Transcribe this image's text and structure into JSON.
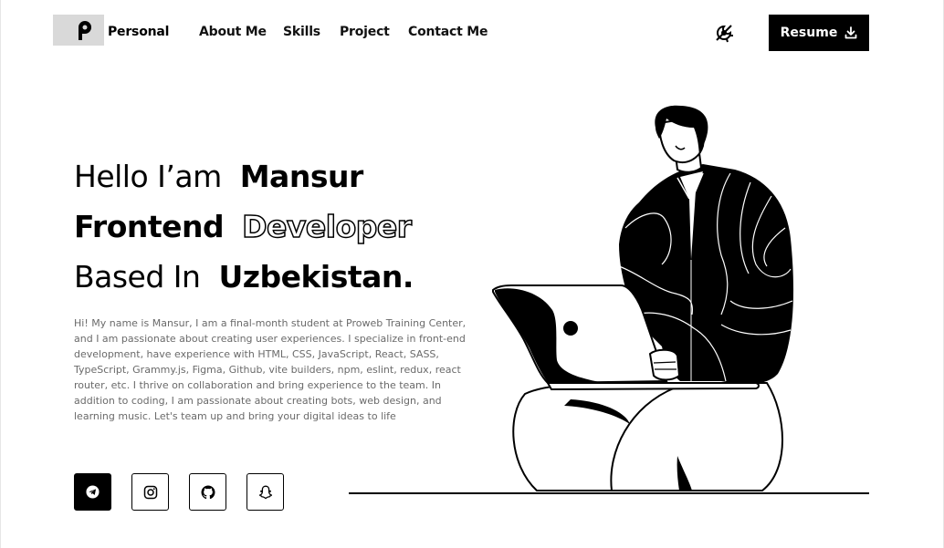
{
  "header": {
    "brand": "Personal",
    "nav": [
      "About Me",
      "Skills",
      "Project",
      "Contact Me"
    ],
    "resume_label": "Resume"
  },
  "hero": {
    "line1_prefix": "Hello I’am",
    "line1_name": "Mansur",
    "line2_role": "Frontend",
    "line2_outline": "Developer",
    "line3_prefix": "Based In",
    "line3_place": "Uzbekistan.",
    "intro": "Hi! My name is Mansur, I am a final-month student at Proweb Training Center, and I am passionate about creating user experiences. I specialize in front-end development, have experience with HTML, CSS, JavaScript, React, SASS, TypeScript, Grammy.js, Figma, Github, vite builders, npm, eslint, redux, react router, etc. I thrive on collaboration and bring experience to the team. In addition to coding, I am passionate about creating bots, web design, and learning music. Let's team up and bring your digital ideas to life"
  },
  "social_icons": [
    "telegram-icon",
    "instagram-icon",
    "github-icon",
    "snapchat-icon"
  ],
  "colors": {
    "primary": "#000000",
    "background": "#ffffff",
    "logo_box": "#d9d9d9",
    "body_text": "#6a6a6a"
  }
}
